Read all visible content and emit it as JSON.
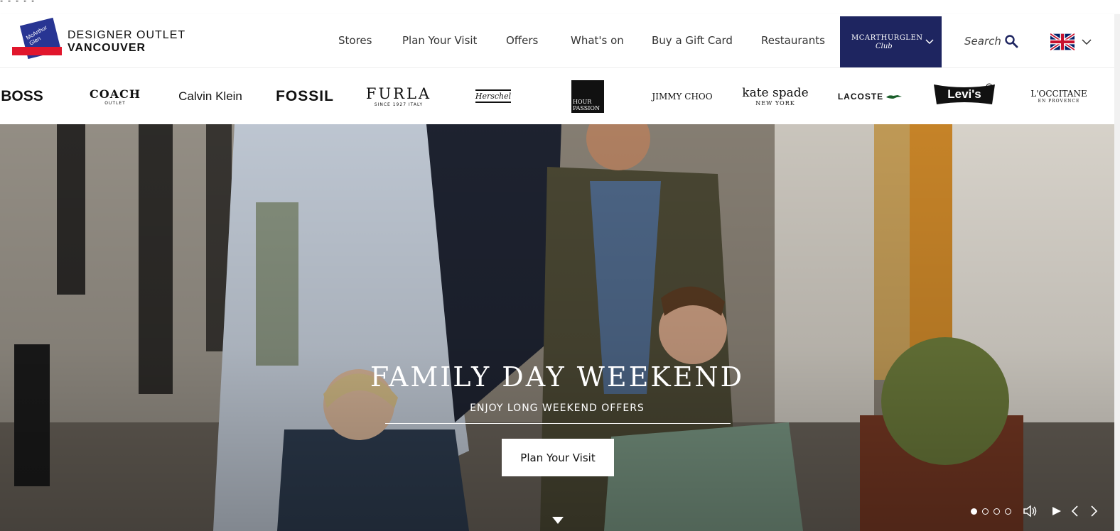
{
  "topstrip": {
    "dots": "\"  \" \" \" \""
  },
  "logo": {
    "mark_text": "McArthur Glen",
    "line1": "DESIGNER OUTLET",
    "line2": "VANCOUVER"
  },
  "nav": {
    "items": [
      {
        "label": "Stores"
      },
      {
        "label": "Plan Your Visit"
      },
      {
        "label": "Offers"
      },
      {
        "label": "What's on"
      },
      {
        "label": "Buy a Gift Card"
      },
      {
        "label": "Restaurants"
      }
    ],
    "club": {
      "line1": "MCARTHURGLEN",
      "line2": "Club"
    },
    "search_label": "Search",
    "language": "English (UK)"
  },
  "brands": {
    "boss": "BOSS",
    "coach": {
      "name": "COACH",
      "sub": "OUTLET"
    },
    "calvin_klein": "Calvin Klein",
    "fossil": "FOSSIL",
    "furla": {
      "name": "FURLA",
      "sub": "SINCE 1927 ITALY"
    },
    "herschel": "Herschel",
    "hour_passion": {
      "line1": "HOUR",
      "line2": "PASSION"
    },
    "jimmy_choo": "JIMMY CHOO",
    "kate_spade": {
      "name": "kate spade",
      "sub": "NEW YORK"
    },
    "lacoste": "LACOSTE",
    "levis": "Levi's",
    "loccitane": {
      "name": "L'OCCITANE",
      "sub": "EN PROVENCE"
    }
  },
  "hero": {
    "title": "FAMILY DAY WEEKEND",
    "subtitle": "ENJOY LONG WEEKEND OFFERS",
    "cta_label": "Plan Your Visit",
    "slides_total": 4,
    "active_slide": 1
  },
  "colors": {
    "club_bg": "#1e2560",
    "logo_blue": "#283593",
    "logo_red": "#e1162c",
    "text": "#333333"
  }
}
